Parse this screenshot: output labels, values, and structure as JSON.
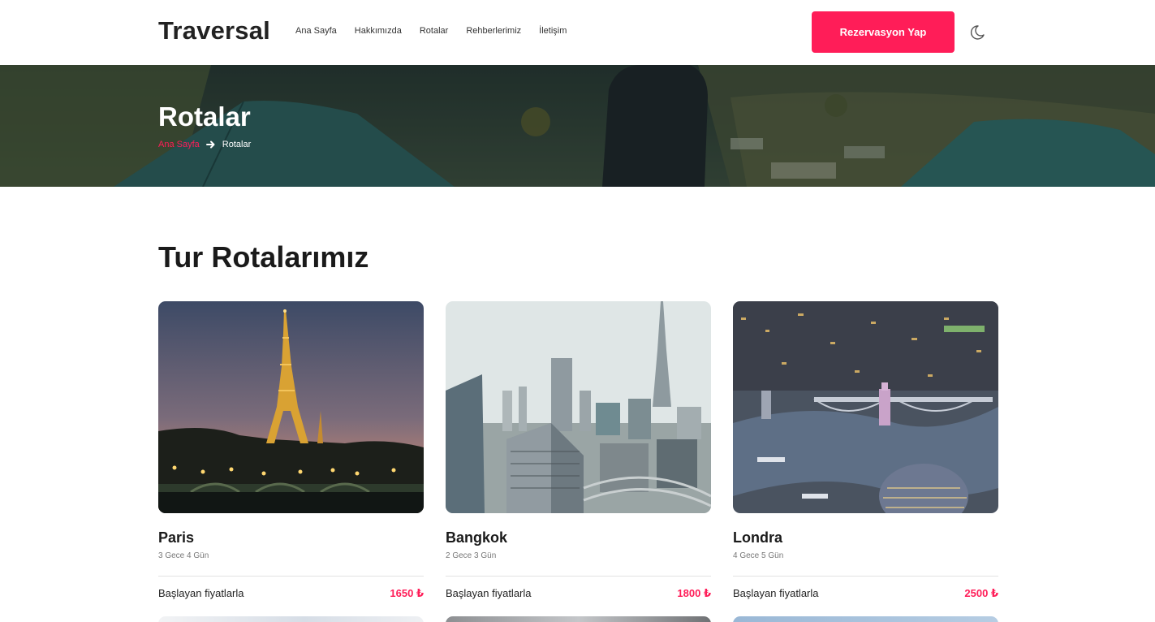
{
  "header": {
    "logo": "Traversal",
    "nav": [
      "Ana Sayfa",
      "Hakkımızda",
      "Rotalar",
      "Rehberlerimiz",
      "İletişim"
    ],
    "cta_label": "Rezervasyon Yap",
    "theme_icon": "moon-icon"
  },
  "hero": {
    "title": "Rotalar",
    "breadcrumb": {
      "home": "Ana Sayfa",
      "current": "Rotalar",
      "separator_icon": "arrow-right-icon"
    }
  },
  "main": {
    "title": "Tur Rotalarımız",
    "cards": [
      {
        "city": "Paris",
        "duration": "3 Gece 4 Gün",
        "price_label": "Başlayan fiyatlarla",
        "price": "1650 ₺"
      },
      {
        "city": "Bangkok",
        "duration": "2 Gece 3 Gün",
        "price_label": "Başlayan fiyatlarla",
        "price": "1800 ₺"
      },
      {
        "city": "Londra",
        "duration": "4 Gece 5 Gün",
        "price_label": "Başlayan fiyatlarla",
        "price": "2500 ₺"
      }
    ]
  },
  "colors": {
    "accent": "#ff1d58",
    "text": "#1a1a1a",
    "muted": "#777777"
  }
}
